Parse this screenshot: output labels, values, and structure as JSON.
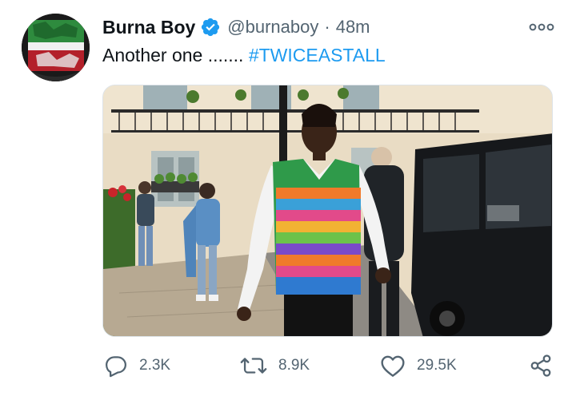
{
  "tweet": {
    "display_name": "Burna Boy",
    "handle": "@burnaboy",
    "separator": "·",
    "time": "48m",
    "text_plain": "Another one .......",
    "hashtag": "#TWICEASTALL",
    "media_alt": "Photo of a man in a colorful knitted vest walking on a London street beside a black van",
    "more_icon": "more-horizontal-icon",
    "verified_icon": "verified-badge-icon"
  },
  "actions": {
    "reply": {
      "icon": "reply-icon",
      "count": "2.3K"
    },
    "retweet": {
      "icon": "retweet-icon",
      "count": "8.9K"
    },
    "like": {
      "icon": "heart-icon",
      "count": "29.5K"
    },
    "share": {
      "icon": "share-icon"
    }
  },
  "colors": {
    "accent": "#1d9bf0",
    "text_primary": "#0f1419",
    "text_secondary": "#536471",
    "background": "#ffffff"
  }
}
